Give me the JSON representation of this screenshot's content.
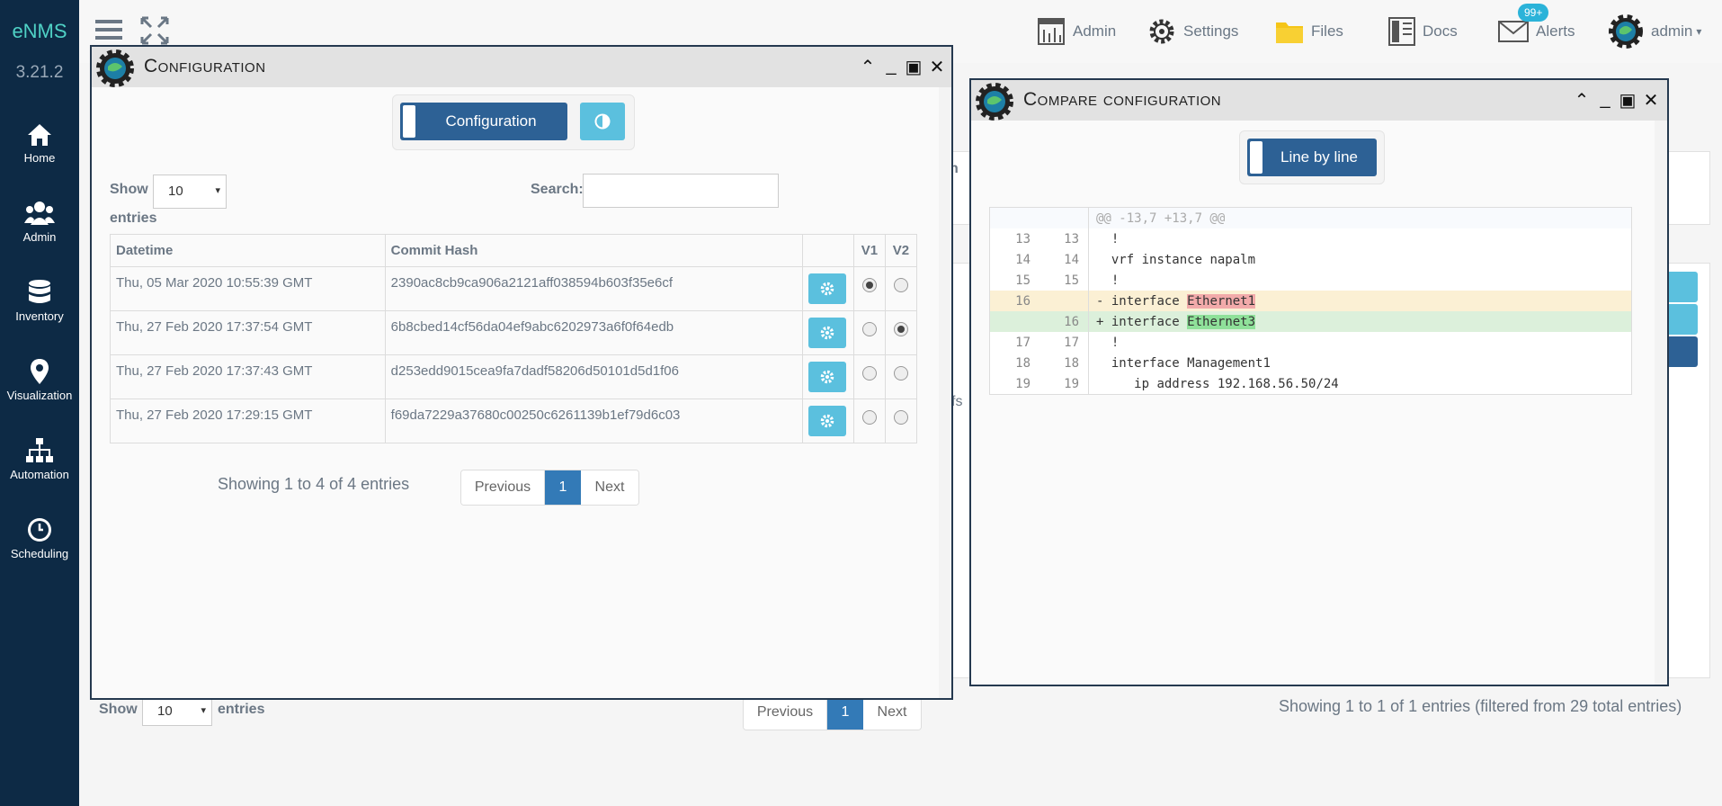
{
  "app": {
    "name": "eNMS",
    "version": "3.21.2"
  },
  "sidebar": {
    "items": [
      {
        "label": "Home",
        "icon": "home-icon"
      },
      {
        "label": "Admin",
        "icon": "users-icon"
      },
      {
        "label": "Inventory",
        "icon": "database-icon"
      },
      {
        "label": "Visualization",
        "icon": "map-marker-icon"
      },
      {
        "label": "Automation",
        "icon": "sitemap-icon"
      },
      {
        "label": "Scheduling",
        "icon": "clock-icon"
      }
    ]
  },
  "topbar": {
    "admin": "Admin",
    "settings": "Settings",
    "files": "Files",
    "docs": "Docs",
    "alerts": "Alerts",
    "alerts_badge": "99+",
    "user": "admin"
  },
  "background": {
    "show_label": "Show",
    "entries_value": "10",
    "entries_label": "entries",
    "pager": {
      "previous": "Previous",
      "page": "1",
      "next": "Next"
    },
    "summary": "Showing 1 to 1 of 1 entries (filtered from 29 total entries)",
    "partial_header": "n",
    "partial_cell": "fs"
  },
  "config_window": {
    "title": "Configuration",
    "toggle_label": "Configuration",
    "show_label": "Show",
    "entries_value": "10",
    "entries_label": "entries",
    "search_label": "Search:",
    "search_value": "",
    "columns": [
      "Datetime",
      "Commit Hash",
      "",
      "V1",
      "V2"
    ],
    "rows": [
      {
        "datetime": "Thu, 05 Mar 2020 10:55:39 GMT",
        "hash": "2390ac8cb9ca906a2121aff038594b603f35e6cf",
        "v1": true,
        "v2": false
      },
      {
        "datetime": "Thu, 27 Feb 2020 17:37:54 GMT",
        "hash": "6b8cbed14cf56da04ef9abc6202973a6f0f64edb",
        "v1": false,
        "v2": true
      },
      {
        "datetime": "Thu, 27 Feb 2020 17:37:43 GMT",
        "hash": "d253edd9015cea9fa7dadf58206d50101d5d1f06",
        "v1": false,
        "v2": false
      },
      {
        "datetime": "Thu, 27 Feb 2020 17:29:15 GMT",
        "hash": "f69da7229a37680c00250c6261139b1ef79d6c03",
        "v1": false,
        "v2": false
      }
    ],
    "summary": "Showing 1 to 4 of 4 entries",
    "pager": {
      "previous": "Previous",
      "page": "1",
      "next": "Next"
    }
  },
  "compare_window": {
    "title": "Compare configuration",
    "toggle_label": "Line by line",
    "hunk": "@@ -13,7 +13,7 @@",
    "lines": [
      {
        "old": "13",
        "new": "13",
        "type": "ctx",
        "prefix": " ",
        "text": "!"
      },
      {
        "old": "14",
        "new": "14",
        "type": "ctx",
        "prefix": " ",
        "text": "vrf instance napalm"
      },
      {
        "old": "15",
        "new": "15",
        "type": "ctx",
        "prefix": " ",
        "text": "!"
      },
      {
        "old": "16",
        "new": "",
        "type": "del",
        "prefix": "-",
        "text": "interface ",
        "highlight": "Ethernet1"
      },
      {
        "old": "",
        "new": "16",
        "type": "ins",
        "prefix": "+",
        "text": "interface ",
        "highlight": "Ethernet3"
      },
      {
        "old": "17",
        "new": "17",
        "type": "ctx",
        "prefix": " ",
        "text": "!"
      },
      {
        "old": "18",
        "new": "18",
        "type": "ctx",
        "prefix": " ",
        "text": "interface Management1"
      },
      {
        "old": "19",
        "new": "19",
        "type": "ctx",
        "prefix": " ",
        "text": "   ip address 192.168.56.50/24"
      }
    ]
  },
  "colors": {
    "sidebar": "#0d2a45",
    "primary": "#2d6195",
    "info": "#5bc0de",
    "brand": "#4fd1c5"
  }
}
